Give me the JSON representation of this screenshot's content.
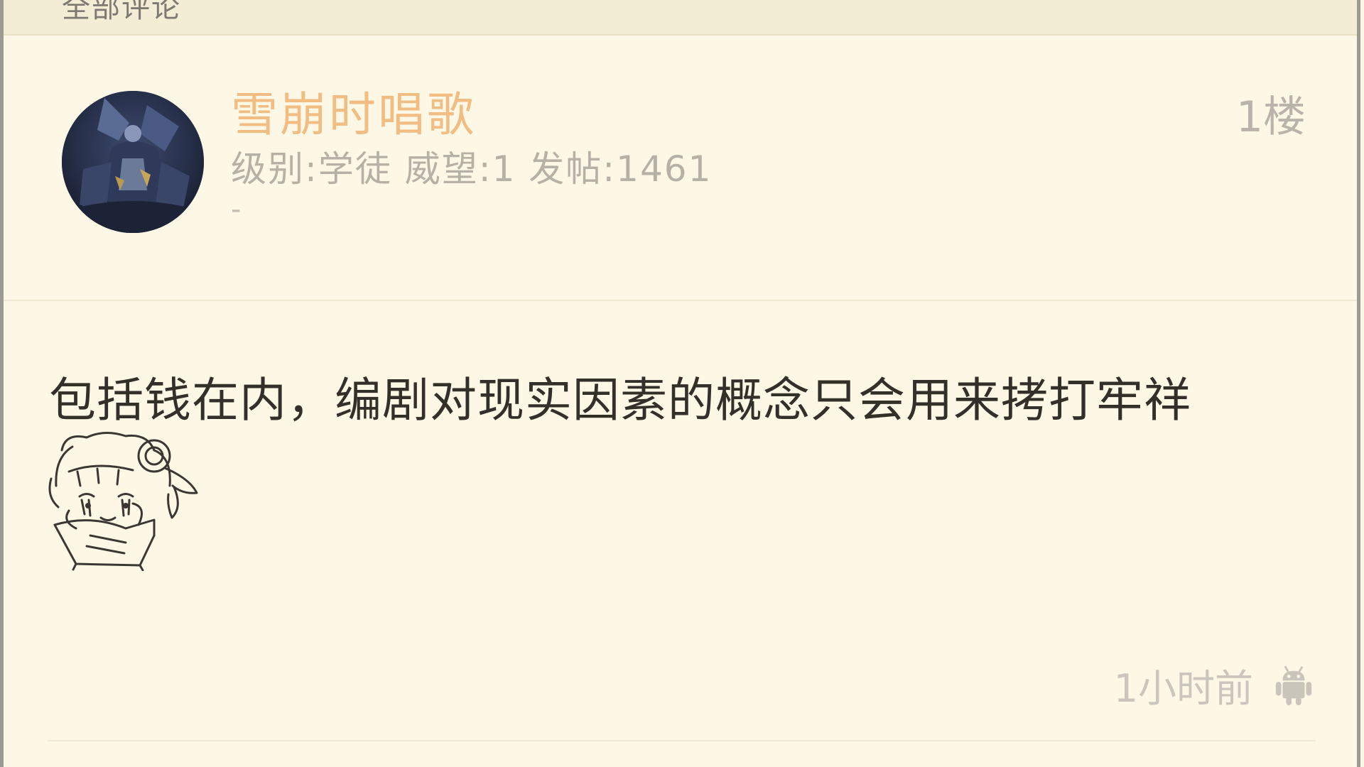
{
  "section": {
    "title": "全部评论"
  },
  "post": {
    "username": "雪崩时唱歌",
    "meta": "级别:学徒 威望:1 发帖:1461",
    "signature": "-",
    "floor": "1楼",
    "content": "包括钱在内，编剧对现实因素的概念只会用来拷打牢祥",
    "time": "1小时前",
    "device_icon": "android-icon",
    "sticker_icon": "anime-girl-sticker",
    "avatar_icon": "user-avatar"
  },
  "colors": {
    "background": "#fdf8e6",
    "header_background": "#f3edd6",
    "username": "#f1bd82",
    "meta_text": "#b5b1a5",
    "content_text": "#333029",
    "muted_text": "#cac6bb"
  }
}
